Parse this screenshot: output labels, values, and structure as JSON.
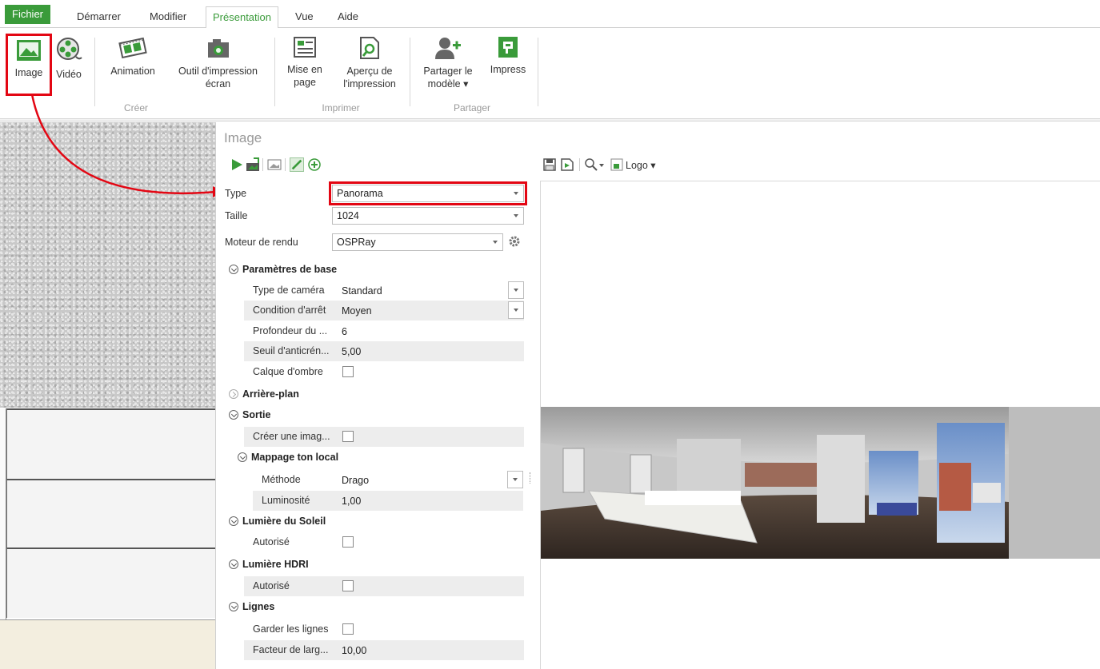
{
  "ribbon": {
    "tabs": [
      {
        "label": "Fichier"
      },
      {
        "label": "Démarrer"
      },
      {
        "label": "Modifier"
      },
      {
        "label": "Présentation"
      },
      {
        "label": "Vue"
      },
      {
        "label": "Aide"
      }
    ],
    "buttons": {
      "image": "Image",
      "video": "Vidéo",
      "animation": "Animation",
      "screen_line1": "Outil d'impression",
      "screen_line2": "écran",
      "layout_line1": "Mise en",
      "layout_line2": "page",
      "preview_line1": "Aperçu de",
      "preview_line2": "l'impression",
      "share_line1": "Partager le",
      "share_line2": "modèle ▾",
      "impress": "Impress"
    },
    "groups": {
      "create": "Créer",
      "print": "Imprimer",
      "share": "Partager"
    }
  },
  "panel": {
    "title": "Image",
    "type_label": "Type",
    "type_value": "Panorama",
    "size_label": "Taille",
    "size_value": "1024",
    "engine_label": "Moteur de rendu",
    "engine_value": "OSPRay",
    "sections": {
      "base": "Paramètres de base",
      "background": "Arrière-plan",
      "output": "Sortie",
      "tonemap": "Mappage ton local",
      "sun": "Lumière du Soleil",
      "hdri": "Lumière HDRI",
      "lines": "Lignes"
    },
    "props": {
      "camera_type": {
        "label": "Type de caméra",
        "value": "Standard"
      },
      "stop_condition": {
        "label": "Condition d'arrêt",
        "value": "Moyen"
      },
      "depth": {
        "label": "Profondeur du ...",
        "value": "6"
      },
      "aa_threshold": {
        "label": "Seuil d'anticrén...",
        "value": "5,00"
      },
      "shadow_layer": {
        "label": "Calque d'ombre"
      },
      "create_image": {
        "label": "Créer une imag..."
      },
      "method": {
        "label": "Méthode",
        "value": "Drago"
      },
      "brightness": {
        "label": "Luminosité",
        "value": "1,00"
      },
      "sun_allowed": {
        "label": "Autorisé"
      },
      "hdri_allowed": {
        "label": "Autorisé"
      },
      "keep_lines": {
        "label": "Garder les lignes"
      },
      "width_factor": {
        "label": "Facteur de larg...",
        "value": "10,00"
      }
    },
    "preview_toolbar": {
      "logo": "Logo ▾"
    }
  },
  "colors": {
    "accent_green": "#3a9b3a",
    "highlight_red": "#e30613"
  }
}
